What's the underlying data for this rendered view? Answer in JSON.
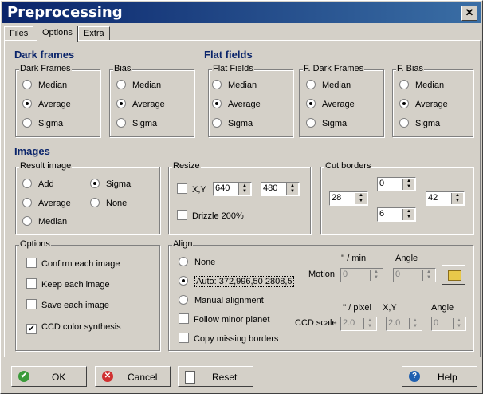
{
  "window": {
    "title": "Preprocessing",
    "close_glyph": "✕"
  },
  "tabs": [
    {
      "label": "Files"
    },
    {
      "label": "Options"
    },
    {
      "label": "Extra"
    }
  ],
  "dark_frames": {
    "section_title": "Dark frames",
    "groups": [
      {
        "title": "Dark Frames",
        "options": [
          "Median",
          "Average",
          "Sigma"
        ],
        "selected": "Average"
      },
      {
        "title": "Bias",
        "options": [
          "Median",
          "Average",
          "Sigma"
        ],
        "selected": "Average"
      }
    ]
  },
  "flat_fields": {
    "section_title": "Flat fields",
    "groups": [
      {
        "title": "Flat Fields",
        "options": [
          "Median",
          "Average",
          "Sigma"
        ],
        "selected": "Average"
      },
      {
        "title": "F. Dark Frames",
        "options": [
          "Median",
          "Average",
          "Sigma"
        ],
        "selected": "Average"
      },
      {
        "title": "F. Bias",
        "options": [
          "Median",
          "Average",
          "Sigma"
        ],
        "selected": "Average"
      }
    ]
  },
  "images": {
    "section_title": "Images",
    "result_image": {
      "title": "Result image",
      "options": [
        "Add",
        "Sigma",
        "Average",
        "None",
        "Median"
      ],
      "selected": "Sigma"
    },
    "resize": {
      "title": "Resize",
      "xy_label": "X,Y",
      "x_value": "640",
      "y_value": "480",
      "drizzle_label": "Drizzle 200%"
    },
    "cut_borders": {
      "title": "Cut borders",
      "top": "0",
      "left": "28",
      "right": "42",
      "bottom": "6"
    }
  },
  "options": {
    "title": "Options",
    "items": [
      {
        "label": "Confirm each image",
        "checked": false
      },
      {
        "label": "Keep each image",
        "checked": false
      },
      {
        "label": "Save each image",
        "checked": false
      },
      {
        "label": "CCD color synthesis",
        "checked": true
      }
    ]
  },
  "align": {
    "title": "Align",
    "none_label": "None",
    "auto_label": "Auto: 372,996,50  2808,5",
    "manual_label": "Manual alignment",
    "follow_label": "Follow minor planet",
    "copy_label": "Copy missing borders",
    "selected": "Auto",
    "motion_unit": "'' / min",
    "angle_label": "Angle",
    "motion_label": "Motion",
    "motion_value": "0",
    "motion_angle": "0",
    "ccd_unit": "'' / pixel",
    "xy_label": "X,Y",
    "angle_label2": "Angle",
    "ccd_scale_label": "CCD scale",
    "ccd_value": "2.0",
    "ccd_xy": "2.0",
    "ccd_angle": "0"
  },
  "buttons": {
    "ok": "OK",
    "cancel": "Cancel",
    "reset": "Reset",
    "help": "Help"
  },
  "colors": {
    "title_bar_start": "#0a246a",
    "section_title": "#0a246a",
    "ok_icon": "#3a9a3a",
    "cancel_icon": "#d03030",
    "help_icon": "#2060b0"
  }
}
